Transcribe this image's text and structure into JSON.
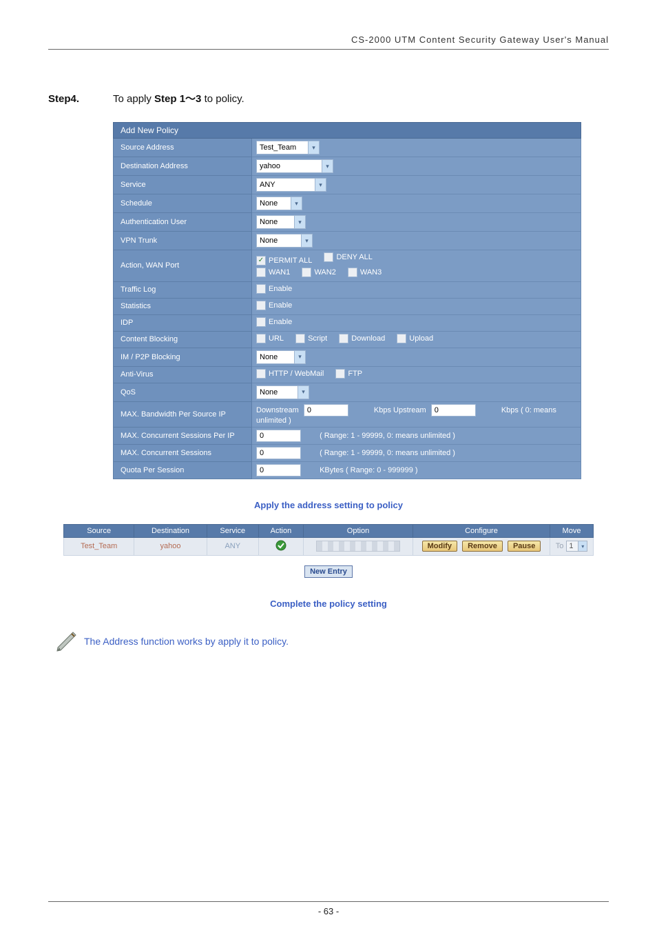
{
  "doc": {
    "header": "CS-2000 UTM Content Security Gateway User's Manual",
    "page_number": "- 63 -"
  },
  "step": {
    "label": "Step4.",
    "text_before": "To apply ",
    "text_bold": "Step 1～3",
    "text_after": " to policy."
  },
  "form": {
    "title": "Add New Policy",
    "rows": {
      "source_address": {
        "label": "Source Address",
        "value": "Test_Team"
      },
      "destination_address": {
        "label": "Destination Address",
        "value": "yahoo"
      },
      "service": {
        "label": "Service",
        "value": "ANY"
      },
      "schedule": {
        "label": "Schedule",
        "value": "None"
      },
      "auth_user": {
        "label": "Authentication User",
        "value": "None"
      },
      "vpn_trunk": {
        "label": "VPN Trunk",
        "value": "None"
      },
      "action_wan": {
        "label": "Action, WAN Port",
        "permit": "PERMIT ALL",
        "deny": "DENY ALL",
        "wan1": "WAN1",
        "wan2": "WAN2",
        "wan3": "WAN3"
      },
      "traffic_log": {
        "label": "Traffic Log",
        "enable": "Enable"
      },
      "statistics": {
        "label": "Statistics",
        "enable": "Enable"
      },
      "idp": {
        "label": "IDP",
        "enable": "Enable"
      },
      "content_blocking": {
        "label": "Content Blocking",
        "url": "URL",
        "script": "Script",
        "download": "Download",
        "upload": "Upload"
      },
      "im_p2p": {
        "label": "IM / P2P Blocking",
        "value": "None"
      },
      "anti_virus": {
        "label": "Anti-Virus",
        "http": "HTTP / WebMail",
        "ftp": "FTP"
      },
      "qos": {
        "label": "QoS",
        "value": "None"
      },
      "max_bw": {
        "label": "MAX. Bandwidth Per Source IP",
        "down_label": "Downstream",
        "down_val": "0",
        "up_label": "Kbps Upstream",
        "up_val": "0",
        "tail": "Kbps ( 0: means unlimited )"
      },
      "max_conc_ip": {
        "label": "MAX. Concurrent Sessions Per IP",
        "val": "0",
        "tail": "( Range: 1 - 99999, 0: means unlimited )"
      },
      "max_conc": {
        "label": "MAX. Concurrent Sessions",
        "val": "0",
        "tail": "( Range: 1 - 99999, 0: means unlimited )"
      },
      "quota": {
        "label": "Quota Per Session",
        "val": "0",
        "tail": "KBytes  ( Range: 0 - 999999 )"
      }
    }
  },
  "captions": {
    "apply": "Apply the address setting to policy",
    "complete": "Complete the policy setting"
  },
  "policy": {
    "headers": {
      "source": "Source",
      "destination": "Destination",
      "service": "Service",
      "action": "Action",
      "option": "Option",
      "configure": "Configure",
      "move": "Move"
    },
    "row": {
      "source": "Test_Team",
      "destination": "yahoo",
      "service": "ANY"
    },
    "buttons": {
      "modify": "Modify",
      "remove": "Remove",
      "pause": "Pause"
    },
    "move": {
      "to": "To",
      "val": "1"
    },
    "new_entry": "New Entry"
  },
  "note": "The Address function works by apply it to policy."
}
